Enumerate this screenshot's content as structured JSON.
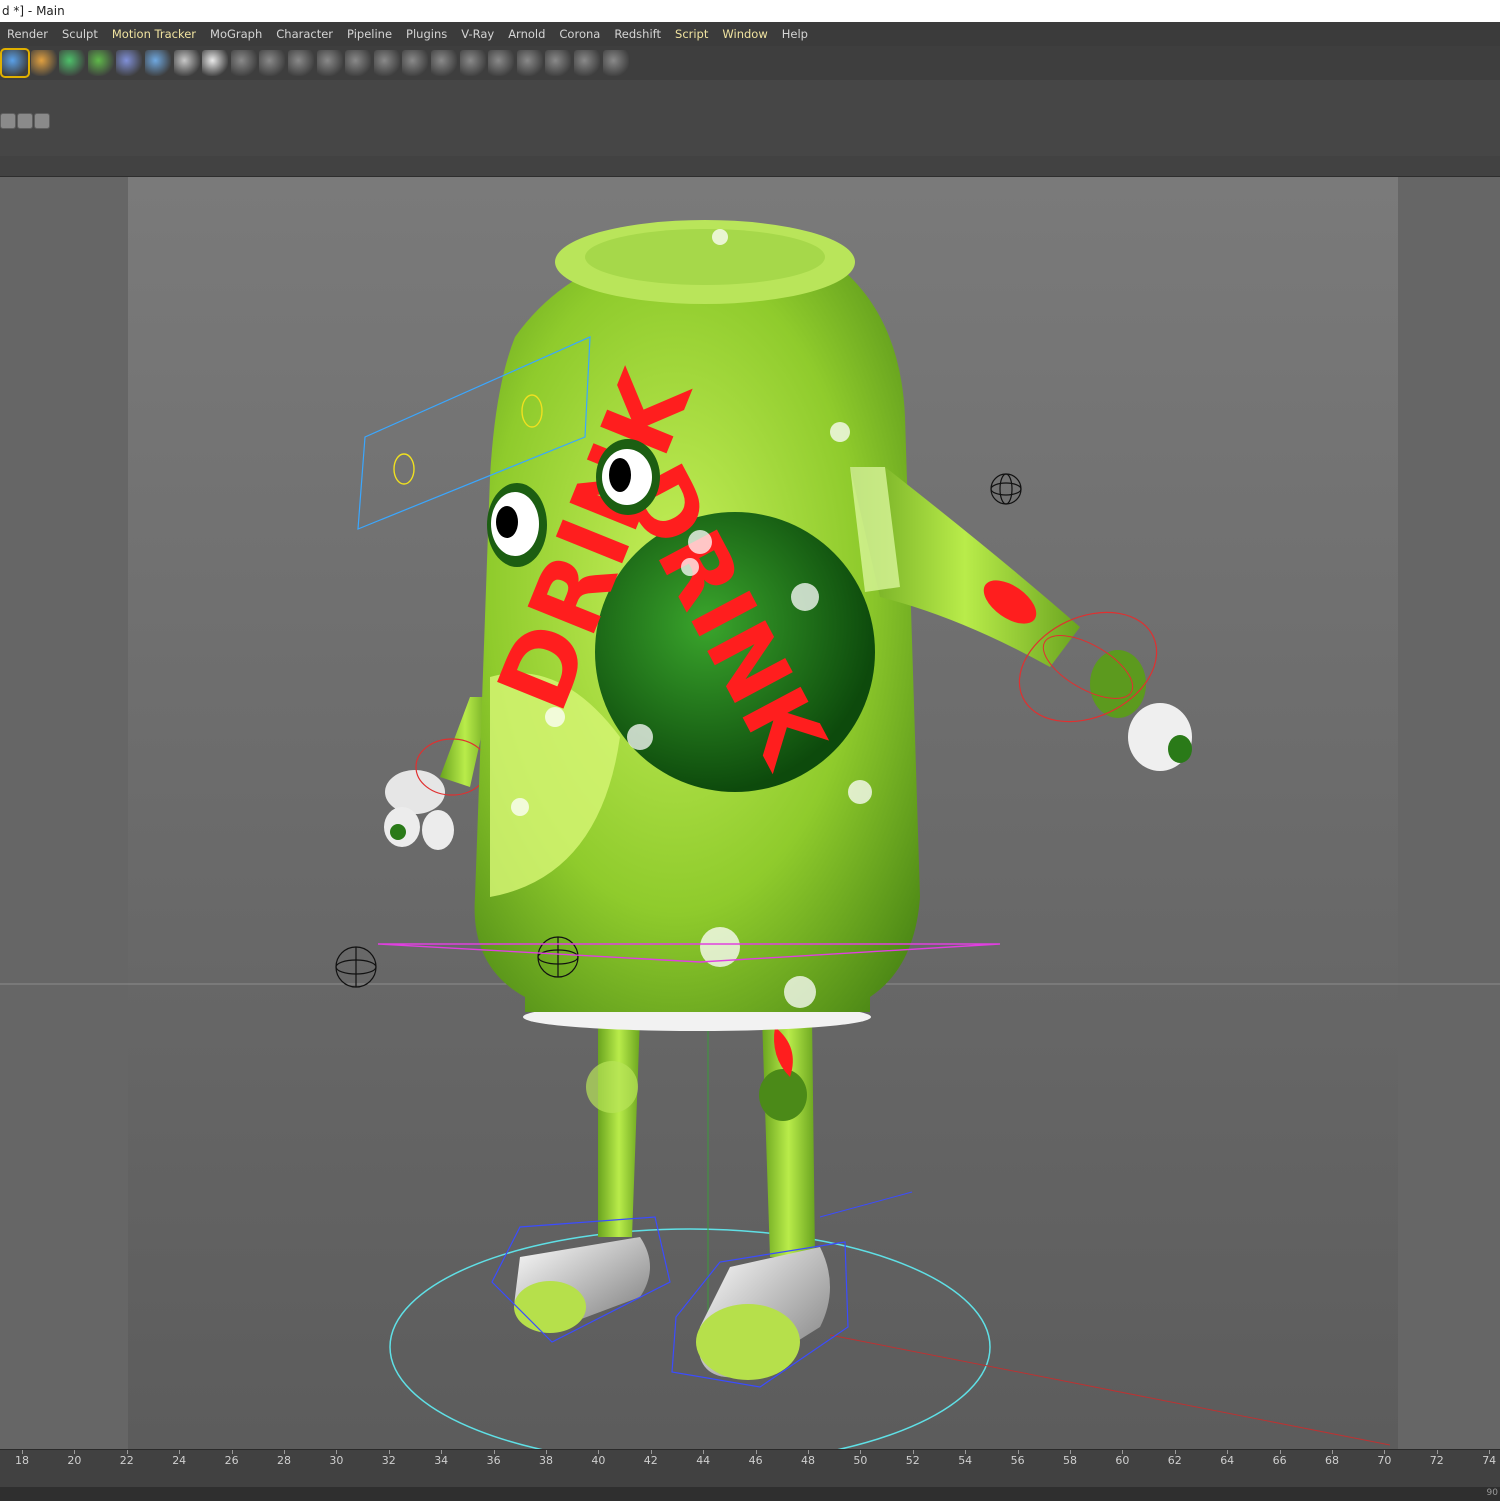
{
  "window": {
    "title": "d *] - Main"
  },
  "menu": {
    "items": [
      "Render",
      "Sculpt",
      "Motion Tracker",
      "MoGraph",
      "Character",
      "Pipeline",
      "Plugins",
      "V-Ray",
      "Arnold",
      "Corona",
      "Redshift",
      "Script",
      "Window",
      "Help"
    ],
    "highlighted": [
      "Motion Tracker",
      "Script",
      "Window"
    ]
  },
  "toolbar": {
    "icons": [
      "cube-icon",
      "pen-icon",
      "subdivision-icon",
      "cloner-icon",
      "deformer-icon",
      "floor-icon",
      "camera-icon",
      "light-icon",
      "array-icon",
      "symmetry-icon",
      "boole-icon",
      "connect-icon",
      "spline-mask-icon",
      "instance-icon",
      "metaball-icon",
      "sweep-icon",
      "loft-icon",
      "extrude-icon",
      "lathe-icon",
      "hair-icon",
      "grid-icon",
      "matrix-icon"
    ]
  },
  "viewport": {
    "label_text": "DRINK",
    "colors": {
      "can": "#9bd23a",
      "can_dark": "#5d9a1f",
      "lettering": "#ff1e1e",
      "shoe": "#d8d8d8",
      "ring": "#5fe0e6"
    }
  },
  "timeline": {
    "ticks": [
      "18",
      "20",
      "22",
      "24",
      "26",
      "28",
      "30",
      "32",
      "34",
      "36",
      "38",
      "40",
      "42",
      "44",
      "46",
      "48",
      "50",
      "52",
      "54",
      "56",
      "58",
      "60",
      "62",
      "64",
      "66",
      "68",
      "70",
      "72",
      "74"
    ],
    "end_label": "90"
  }
}
